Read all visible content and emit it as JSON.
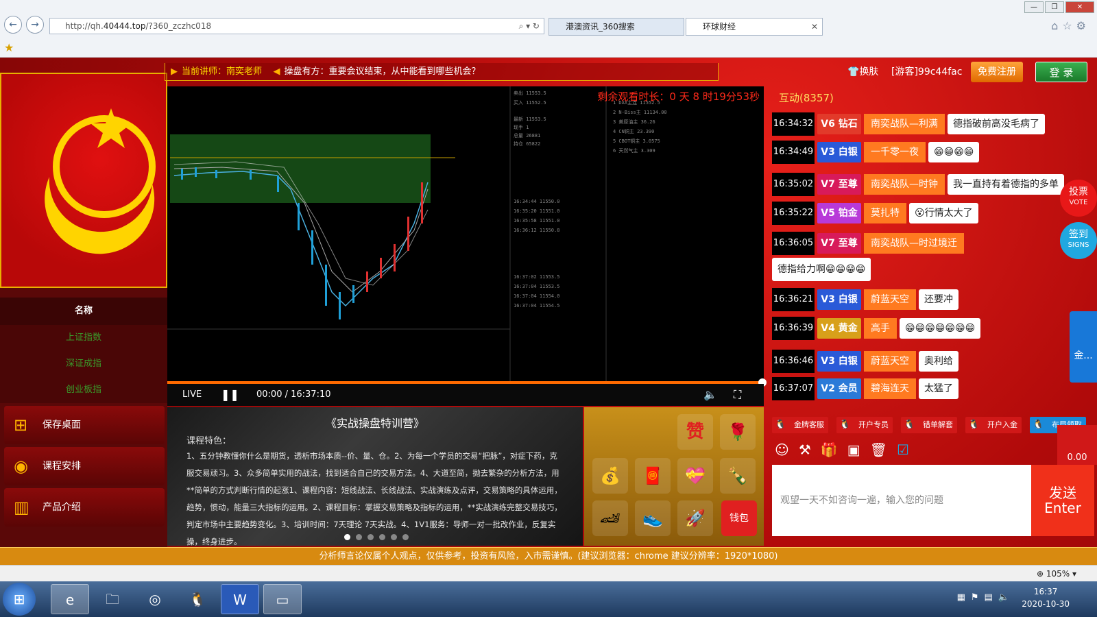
{
  "browser": {
    "url_prefix": "http://qh.",
    "url_domain": "40444.top",
    "url_path": "/?360_zczhc018",
    "tabs": [
      {
        "label": "港澳资讯_360搜索",
        "active": false
      },
      {
        "label": "环球财经",
        "active": true
      }
    ],
    "zoom": "105%"
  },
  "top_strip": {
    "teacher": "当前讲师：南奕老师",
    "marquee": "操盘有方：重要会议结束，从中能看到哪些机会？"
  },
  "left": {
    "name_header": "名称",
    "indexes": [
      "上证指数",
      "深证成指",
      "创业板指"
    ],
    "buttons": [
      {
        "label": "保存桌面",
        "icon": "windows-icon"
      },
      {
        "label": "课程安排",
        "icon": "globe-icon"
      },
      {
        "label": "产品介绍",
        "icon": "chart-icon"
      }
    ]
  },
  "video": {
    "countdown": "剩余观看时长：0 天 8 时19分53秒",
    "live": "LIVE",
    "time": "00:00 / 16:37:10",
    "progress": 1.0
  },
  "course": {
    "title": "《实战操盘特训营》",
    "subtitle": "课程特色：",
    "body": "1、五分钟教懂你什么是期货，透析市场本质--价、量、仓。2、为每一个学员的交易“把脉”，对症下药，克服交易顽习。3、众多简单实用的战法，找到适合自己的交易方法。4、大道至简，抛去繁杂的分析方法，用**简单的方式判断行情的起涨1、课程内容：短线战法、长线战法、实战演练及点评，交易策略的具体运用，趋势，惯动，能量三大指标的运用。2、课程目标：掌握交易策略及指标的运用，**实战演练完整交易技巧，判定市场中主要趋势变化。3、培训时间：7天理论 7天实战。4、1V1服务：导师一对一批改作业，反复实操，终身进步。",
    "dots": 6
  },
  "gifts": {
    "wallet": "钱包",
    "items": [
      "赞",
      "🌹",
      "💰",
      "🧧",
      "💝",
      "🍾",
      "🏎",
      "👟",
      "🚀"
    ]
  },
  "right": {
    "skin": "换肤",
    "guest": "[游客]99c44fac",
    "register": "免费注册",
    "login": "登 录",
    "interact": "互动(8357)",
    "messages": [
      {
        "time": "16:34:32",
        "level": "V6 钻石",
        "color": "#e23a2a",
        "nick": "南奕战队—利满",
        "text": "德指破前高没毛病了"
      },
      {
        "time": "16:34:49",
        "level": "V3 白银",
        "color": "#2a5ad8",
        "nick": "一千零一夜",
        "text": "😁😁😁😁"
      },
      {
        "time": "16:35:02",
        "level": "V7 至尊",
        "color": "#d81a5a",
        "nick": "南奕战队—时钟",
        "text": "我一直持有着德指的多单"
      },
      {
        "time": "16:35:22",
        "level": "V5 铂金",
        "color": "#b83ad8",
        "nick": "莫扎特",
        "text": "😮行情太大了"
      },
      {
        "time": "16:36:05",
        "level": "V7 至尊",
        "color": "#d81a5a",
        "nick": "南奕战队—时过境迁",
        "text": ""
      },
      {
        "time": "",
        "level": "",
        "color": "",
        "nick": "",
        "text": "德指给力啊😁😁😁😁"
      },
      {
        "time": "16:36:21",
        "level": "V3 白银",
        "color": "#2a5ad8",
        "nick": "蔚蓝天空",
        "text": "还要冲"
      },
      {
        "time": "16:36:39",
        "level": "V4 黄金",
        "color": "#d8a01a",
        "nick": "高手",
        "text": "😁😁😁😁😁😁😁"
      },
      {
        "time": "16:36:46",
        "level": "V3 白银",
        "color": "#2a5ad8",
        "nick": "蔚蓝天空",
        "text": "奥利给"
      },
      {
        "time": "16:37:07",
        "level": "V2 会员",
        "color": "#2a7ad8",
        "nick": "碧海连天",
        "text": "太猛了"
      }
    ],
    "services": [
      "金牌客服",
      "开户专员",
      "错单解套",
      "开户入金",
      "布局领取"
    ],
    "input_placeholder": "观望一天不如咨询一遍，输入您的问题",
    "send": "发送",
    "send_en": "Enter",
    "vote": "投票",
    "vote_en": "VOTE",
    "sign": "签到",
    "sign_en": "SIGNS",
    "side_tab": "金...",
    "redpacket": "0.00"
  },
  "footer": "分析师言论仅属个人观点，仅供参考，投资有风险，入市需谨慎。(建议浏览器：chrome 建议分辨率：1920*1080)",
  "clock": {
    "time": "16:37",
    "date": "2020-10-30"
  }
}
